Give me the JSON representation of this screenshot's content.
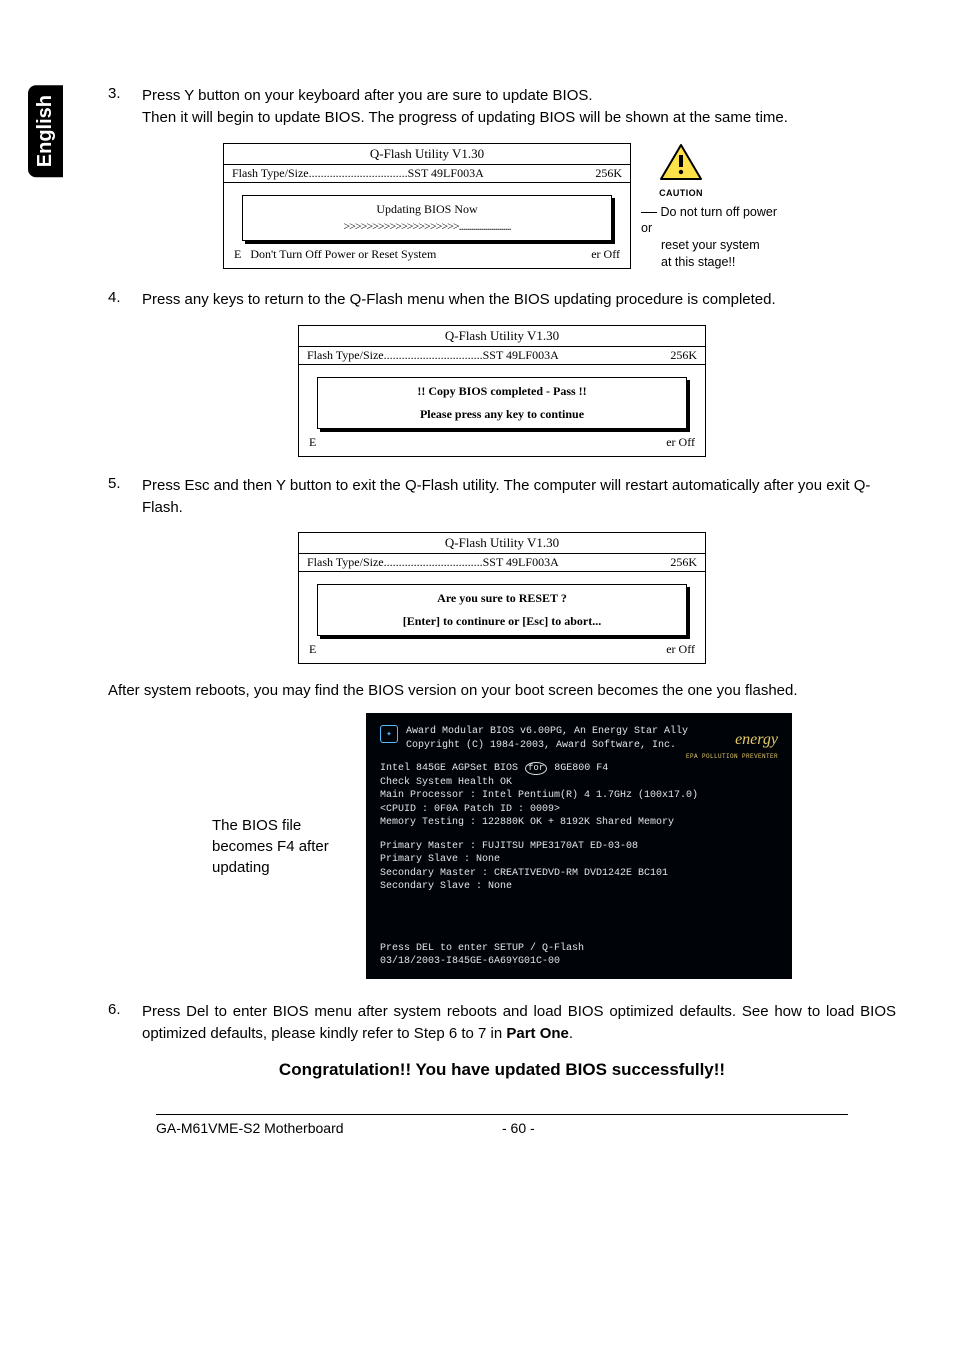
{
  "langTab": "English",
  "steps": {
    "s3": {
      "num": "3.",
      "line1": "Press Y button on your keyboard after you are sure to update BIOS.",
      "line2": "Then it will begin to update BIOS. The progress of updating BIOS will be shown at the same time."
    },
    "s4": {
      "num": "4.",
      "text": "Press any keys to return to the Q-Flash menu when the BIOS updating procedure is completed."
    },
    "s5": {
      "num": "5.",
      "text": "Press Esc and then Y button to exit the Q-Flash utility. The computer will restart automatically after you exit Q-Flash."
    },
    "s6": {
      "num": "6.",
      "text": "Press Del to enter BIOS menu after system reboots and load BIOS optimized defaults. See how to load BIOS optimized defaults, please kindly refer to Step 6 to 7 in ",
      "bold": "Part One",
      "tail": "."
    }
  },
  "qflash": {
    "title": "Q-Flash Utility V1.30",
    "flashLabel": "Flash Type/Size.................................SST 49LF003A",
    "size": "256K",
    "p1": {
      "l1": "Updating BIOS Now",
      "l2": ">>>>>>>>>>>>>>>>>>>>..........................",
      "bottom": "Don't Turn Off Power or Reset System",
      "rowL": "E",
      "rowR": "er Off"
    },
    "p2": {
      "l1": "!! Copy BIOS completed - Pass !!",
      "l2": "Please press any key to continue",
      "rowL": "E",
      "rowR": "er Off"
    },
    "p3": {
      "l1": "Are you sure to RESET ?",
      "l2": "[Enter] to continure or [Esc] to abort...",
      "rowL": "E",
      "rowR": "er Off"
    }
  },
  "caution": {
    "label": "CAUTION",
    "l1": "Do not turn off power or",
    "l2": "reset your system",
    "l3": "at this stage!!"
  },
  "afterReboot": "After system reboots, you may find the BIOS version on your boot screen becomes the one you flashed.",
  "sideNote": "The BIOS file becomes F4 after updating",
  "boot": {
    "l1": "Award Modular BIOS v6.00PG, An Energy Star Ally",
    "l2": "Copyright (C) 1984-2003, Award Software, Inc.",
    "l3a": "Intel 845GE AGPSet BIOS ",
    "l3b": "for",
    "l3c": " 8GE800 F4",
    "l4": "Check System Health OK",
    "l5": "Main Processor : Intel Pentium(R) 4  1.7GHz (100x17.0)",
    "l6": "<CPUID : 0F0A Patch ID  : 0009>",
    "l7": "Memory Testing  : 122880K OK + 8192K Shared Memory",
    "l8": "Primary Master : FUJITSU MPE3170AT ED-03-08",
    "l9": "Primary Slave : None",
    "l10": "Secondary Master : CREATIVEDVD-RM DVD1242E BC101",
    "l11": "Secondary Slave : None",
    "l12": "Press DEL to enter SETUP / Q-Flash",
    "l13": "03/18/2003-I845GE-6A69YG01C-00",
    "energy": "energy",
    "energySub": "EPA  POLLUTION PREVENTER"
  },
  "congrat": "Congratulation!! You have updated BIOS successfully!!",
  "footer": {
    "left": "GA-M61VME-S2 Motherboard",
    "center": "- 60 -"
  }
}
